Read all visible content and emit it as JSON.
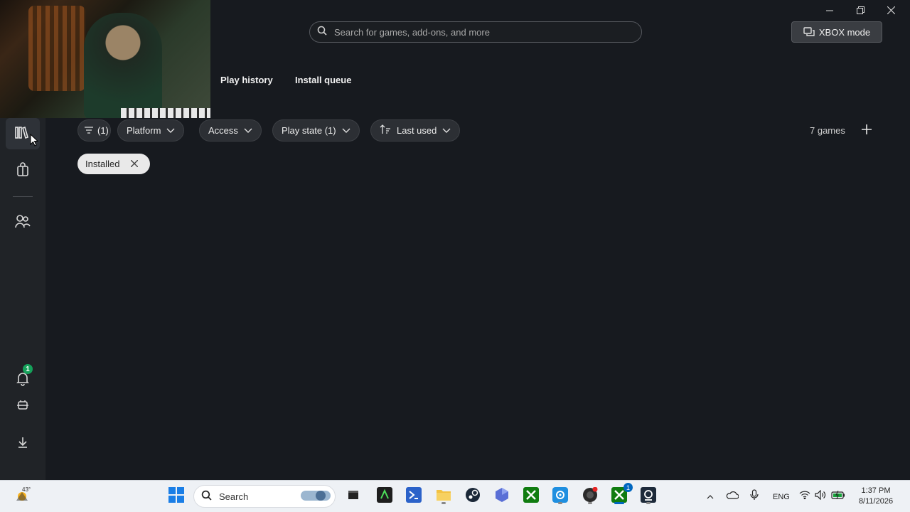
{
  "header": {
    "search_placeholder": "Search for games, add-ons, and more",
    "xbox_mode_label": "XBOX mode"
  },
  "tabs": [
    {
      "label": "Play history"
    },
    {
      "label": "Install queue"
    }
  ],
  "filters": {
    "filter_count_label": "(1)",
    "platform_label": "Platform",
    "access_label": "Access",
    "play_state_label": "Play state (1)",
    "sort_label": "Last used",
    "games_count": "7 games",
    "active_filter": "Installed"
  },
  "sidebar": {
    "notification_count": "1"
  },
  "taskbar": {
    "weather_temp": "43°",
    "search_label": "Search",
    "language": "ENG",
    "time": "1:37 PM",
    "date": "8/11/2026",
    "xbox_badge": "1"
  },
  "colors": {
    "background": "#171a1f",
    "rail": "#202327",
    "chip": "#2c2f34",
    "accent_green": "#15a15a",
    "taskbar": "#eef1f5"
  }
}
